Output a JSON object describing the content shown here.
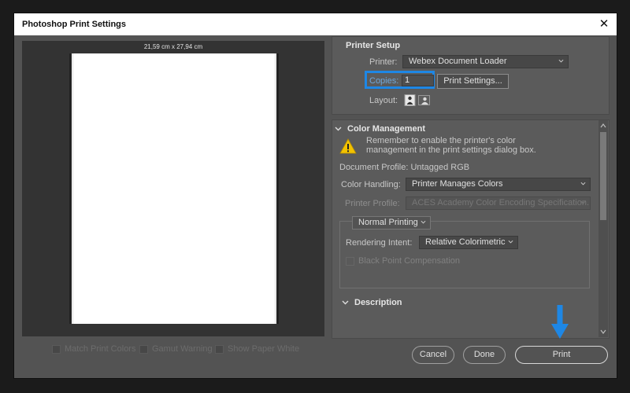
{
  "window": {
    "title": "Photoshop Print Settings"
  },
  "preview": {
    "dimensions": "21,59 cm x 27,94 cm"
  },
  "options": [
    {
      "label": "Match Print Colors"
    },
    {
      "label": "Gamut Warning"
    },
    {
      "label": "Show Paper White"
    }
  ],
  "printer_setup": {
    "header": "Printer Setup",
    "printer_label": "Printer:",
    "printer_value": "Webex Document Loader",
    "copies_label": "Copies:",
    "copies_value": "1",
    "print_settings_label": "Print Settings...",
    "layout_label": "Layout:"
  },
  "color_management": {
    "header": "Color Management",
    "notice_line1": "Remember to enable the printer's color",
    "notice_line2": "management in the print settings dialog box.",
    "document_profile": "Document Profile: Untagged RGB",
    "color_handling_label": "Color Handling:",
    "color_handling_value": "Printer Manages Colors",
    "printer_profile_label": "Printer Profile:",
    "printer_profile_value": "ACES Academy Color Encoding Specification...",
    "printing_mode": "Normal Printing",
    "rendering_intent_label": "Rendering Intent:",
    "rendering_intent_value": "Relative Colorimetric",
    "black_point_label": "Black Point Compensation"
  },
  "description": {
    "header": "Description"
  },
  "footer": {
    "cancel_label": "Cancel",
    "done_label": "Done",
    "print_label": "Print"
  },
  "colors": {
    "highlight": "#1e87e5",
    "warning": "#f2c200",
    "panel": "#5b5b5b",
    "background": "#535353"
  }
}
